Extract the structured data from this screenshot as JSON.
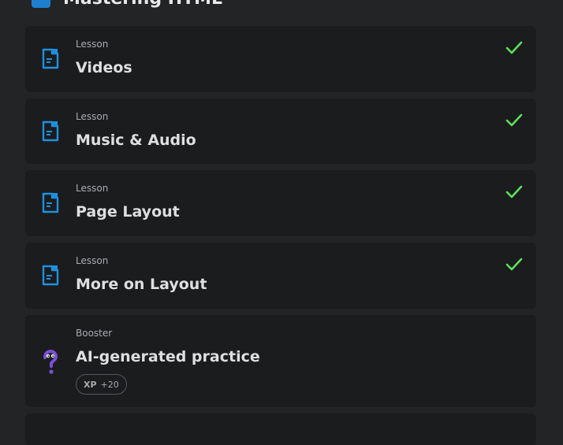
{
  "section": {
    "title": "Mastering HTML"
  },
  "items": [
    {
      "kind": "Lesson",
      "title": "Videos",
      "completed": true
    },
    {
      "kind": "Lesson",
      "title": "Music & Audio",
      "completed": true
    },
    {
      "kind": "Lesson",
      "title": "Page Layout",
      "completed": true
    },
    {
      "kind": "Lesson",
      "title": "More on Layout",
      "completed": true
    },
    {
      "kind": "Booster",
      "title": "AI-generated practice",
      "xp_label": "XP",
      "xp_value": "+20"
    }
  ],
  "colors": {
    "accent": "#1e90e0",
    "check": "#5ee05a",
    "booster": "#7b4fd6"
  }
}
